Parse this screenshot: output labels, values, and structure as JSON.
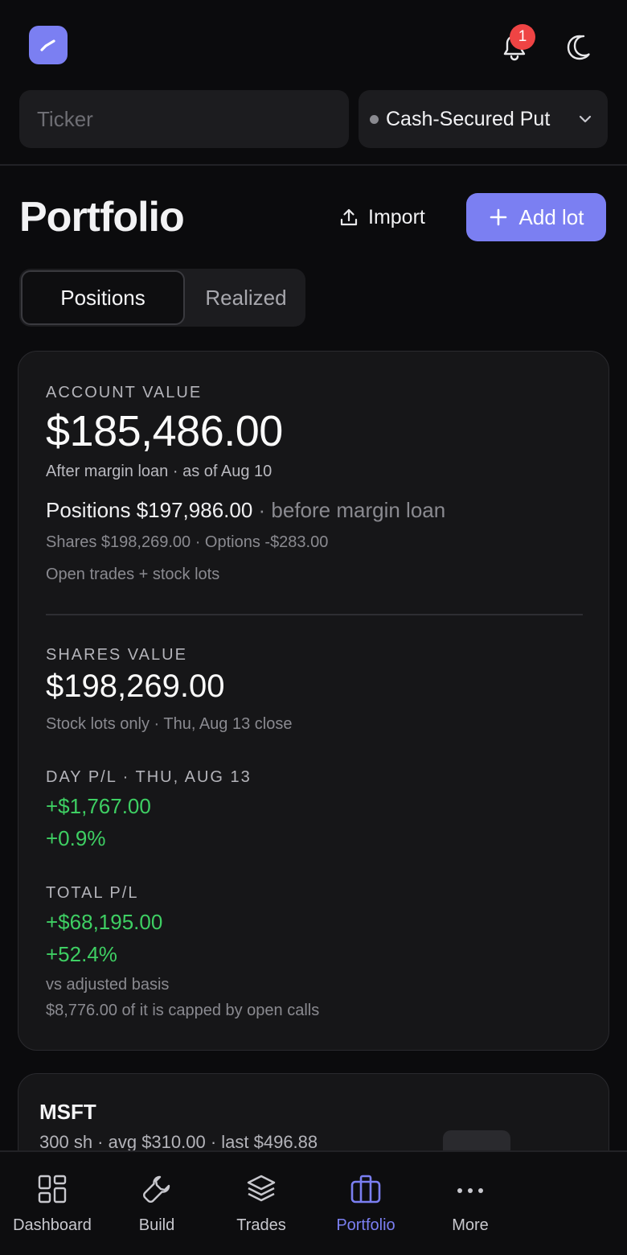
{
  "header": {
    "notification_count": "1",
    "icons": [
      "logo-icon",
      "bell-icon",
      "moon-icon"
    ]
  },
  "filters": {
    "ticker_placeholder": "Ticker",
    "strategy_label": "Cash-Secured Put"
  },
  "page": {
    "title": "Portfolio",
    "import_label": "Import",
    "add_label": "Add lot"
  },
  "tabs": [
    {
      "label": "Positions",
      "active": true
    },
    {
      "label": "Realized",
      "active": false
    }
  ],
  "summary": {
    "account_value_label": "ACCOUNT VALUE",
    "account_value": "$185,486.00",
    "account_note": "After margin loan · as of Aug 10",
    "positions_value": "Positions $197,986.00",
    "positions_note": " · before margin loan",
    "breakdown": "Shares $198,269.00 · Options -$283.00",
    "source_note": "Open trades + stock lots",
    "shares_value_label": "SHARES VALUE",
    "shares_value": "$198,269.00",
    "shares_note": "Stock lots only · Thu, Aug 13 close",
    "day_pl_label": "DAY P/L · THU, AUG 13",
    "day_pl_value": "+$1,767.00",
    "day_pl_pct": "+0.9%",
    "total_pl_label": "TOTAL P/L",
    "total_pl_value": "+$68,195.00",
    "total_pl_pct": "+52.4%",
    "total_pl_note": "vs adjusted basis",
    "capped_note": "$8,776.00 of it is capped by open calls"
  },
  "positions": [
    {
      "ticker": "MSFT",
      "detail": "300 sh · avg $310.00 · last $496.88"
    }
  ],
  "nav": [
    {
      "label": "Dashboard",
      "icon": "grid-icon",
      "active": false
    },
    {
      "label": "Build",
      "icon": "wrench-icon",
      "active": false
    },
    {
      "label": "Trades",
      "icon": "layers-icon",
      "active": false
    },
    {
      "label": "Portfolio",
      "icon": "briefcase-icon",
      "active": true
    },
    {
      "label": "More",
      "icon": "more-dots-icon",
      "active": false
    }
  ],
  "colors": {
    "accent": "#7b7ff2",
    "positive": "#3ecf63",
    "badge": "#ef4444",
    "background": "#0b0b0d",
    "card": "#161618"
  }
}
